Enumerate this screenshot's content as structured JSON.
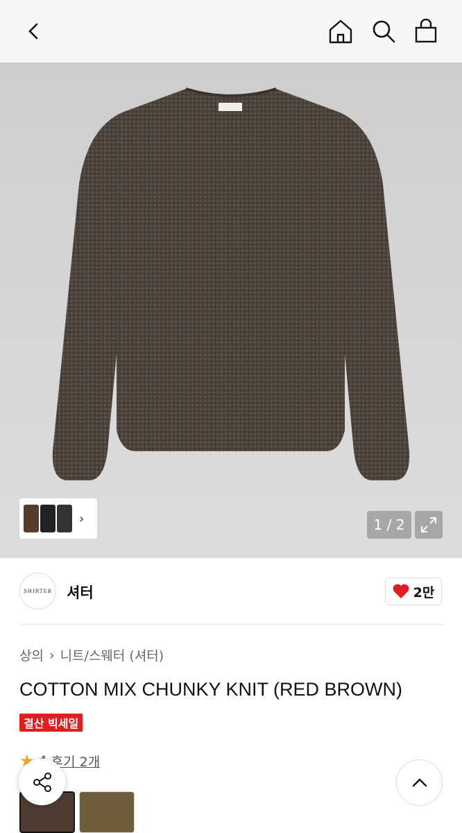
{
  "header": {
    "back_icon": "chevron-left-icon",
    "home_icon": "home-icon",
    "search_icon": "search-icon",
    "bag_icon": "shopping-bag-icon"
  },
  "gallery": {
    "pager_text": "1 / 2",
    "expand_icon": "expand-icon",
    "thumb_arrow": "›"
  },
  "brand": {
    "logo_text": "SHIRTER",
    "name": "셔터",
    "like_count": "2만"
  },
  "product": {
    "breadcrumb": [
      "상의",
      "니트/스웨터 (셔터)"
    ],
    "breadcrumb_separator": "›",
    "title": "COTTON MIX CHUNKY KNIT (RED BROWN)",
    "sale_badge": "결산 빅세일",
    "rating": "4",
    "review_link": "후기 2개"
  },
  "colors": {
    "sale_red": "#e01e1e",
    "heart_red": "#e31b23",
    "star": "#f5a623"
  }
}
